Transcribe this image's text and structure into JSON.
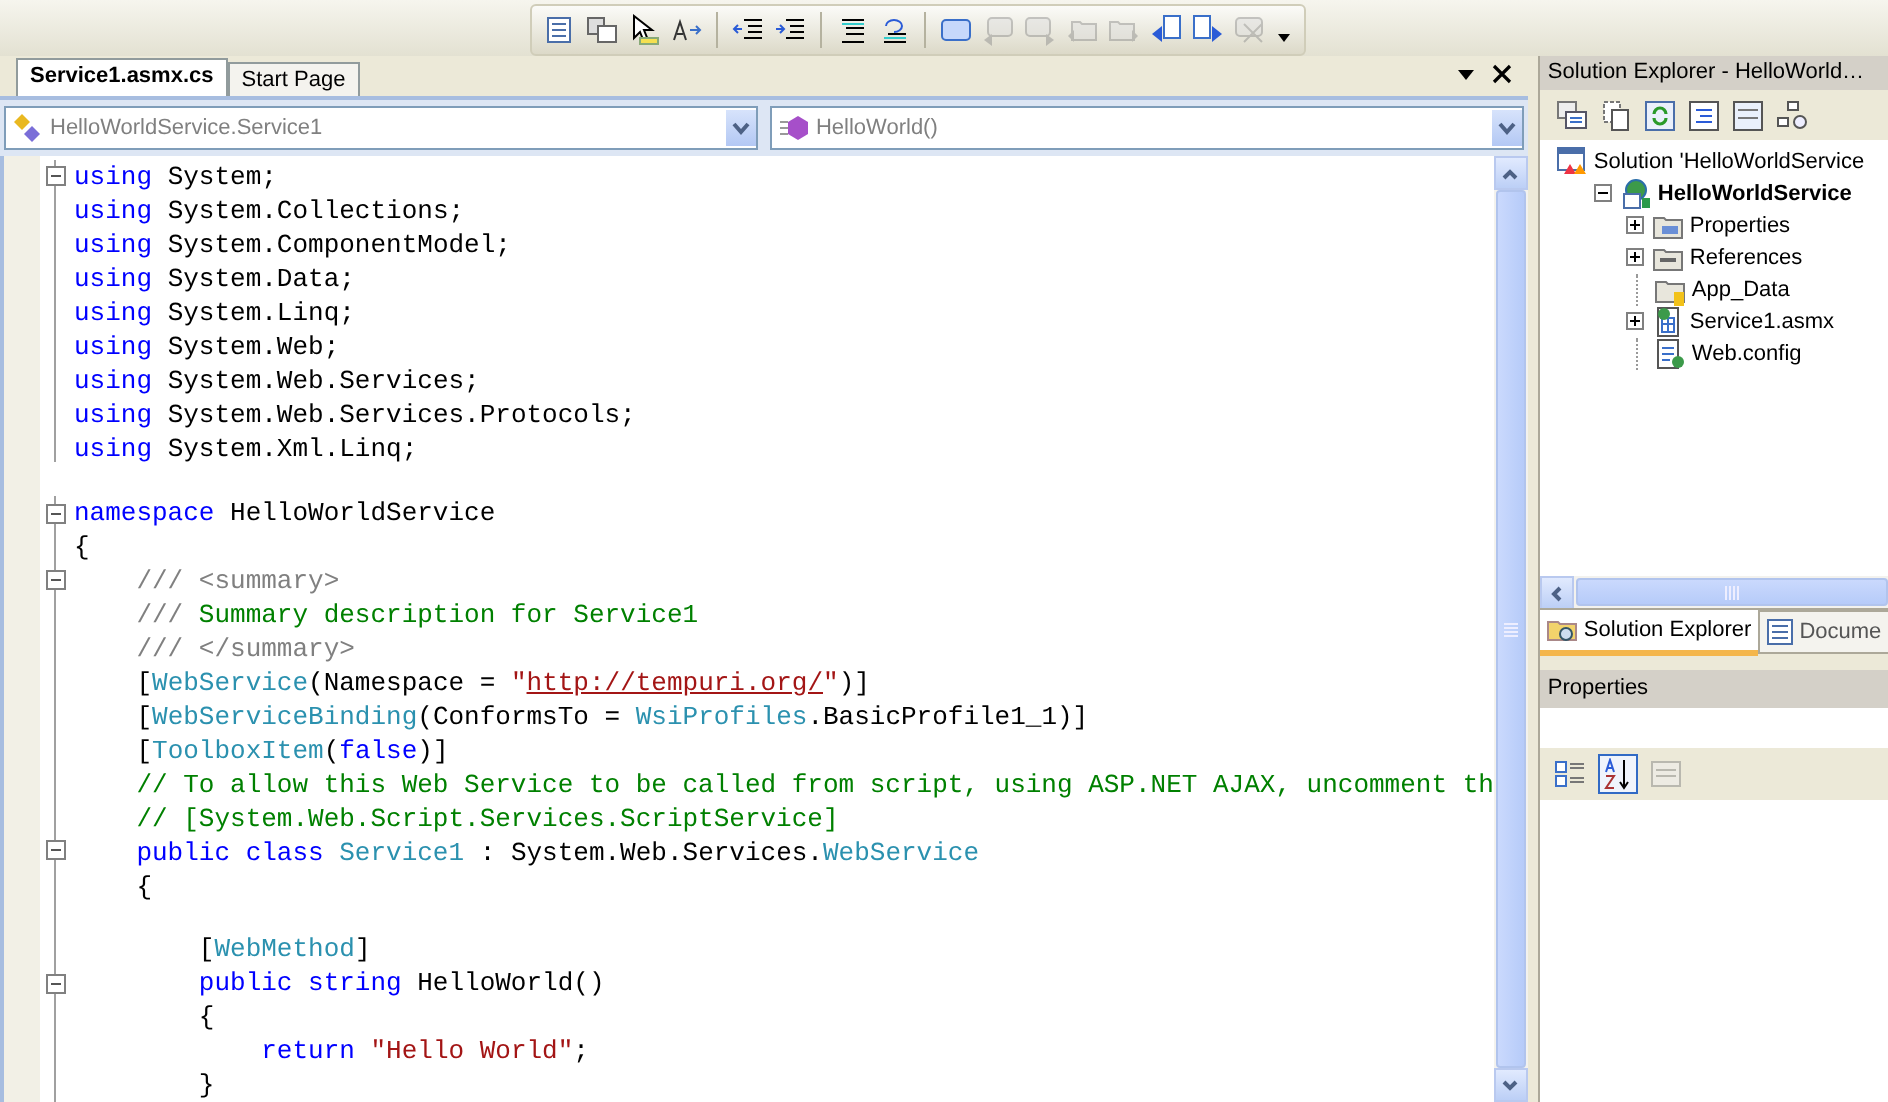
{
  "editor_tabs": [
    {
      "label": "Service1.asmx.cs",
      "selected": true
    },
    {
      "label": "Start Page",
      "selected": false
    }
  ],
  "type_dropdown": {
    "value": "HelloWorldService.Service1"
  },
  "member_dropdown": {
    "value": "HelloWorld()"
  },
  "code_lines": [
    {
      "collapsible": true,
      "tokens": [
        {
          "kind": "kw",
          "text": "using"
        },
        {
          "kind": "plain",
          "text": " System;"
        }
      ]
    },
    {
      "tokens": [
        {
          "kind": "kw",
          "text": "using"
        },
        {
          "kind": "plain",
          "text": " System.Collections;"
        }
      ]
    },
    {
      "tokens": [
        {
          "kind": "kw",
          "text": "using"
        },
        {
          "kind": "plain",
          "text": " System.ComponentModel;"
        }
      ]
    },
    {
      "tokens": [
        {
          "kind": "kw",
          "text": "using"
        },
        {
          "kind": "plain",
          "text": " System.Data;"
        }
      ]
    },
    {
      "tokens": [
        {
          "kind": "kw",
          "text": "using"
        },
        {
          "kind": "plain",
          "text": " System.Linq;"
        }
      ]
    },
    {
      "tokens": [
        {
          "kind": "kw",
          "text": "using"
        },
        {
          "kind": "plain",
          "text": " System.Web;"
        }
      ]
    },
    {
      "tokens": [
        {
          "kind": "kw",
          "text": "using"
        },
        {
          "kind": "plain",
          "text": " System.Web.Services;"
        }
      ]
    },
    {
      "tokens": [
        {
          "kind": "kw",
          "text": "using"
        },
        {
          "kind": "plain",
          "text": " System.Web.Services.Protocols;"
        }
      ]
    },
    {
      "tokens": [
        {
          "kind": "kw",
          "text": "using"
        },
        {
          "kind": "plain",
          "text": " System.Xml.Linq;"
        }
      ]
    },
    {
      "kind": "gap"
    },
    {
      "collapsible": true,
      "tokens": [
        {
          "kind": "kw",
          "text": "namespace"
        },
        {
          "kind": "plain",
          "text": " HelloWorldService"
        }
      ]
    },
    {
      "tokens": [
        {
          "kind": "plain",
          "text": "{"
        }
      ]
    },
    {
      "collapsible": true,
      "tokens": [
        {
          "kind": "doc",
          "text": "    /// <summary>"
        }
      ]
    },
    {
      "tokens": [
        {
          "kind": "doc",
          "text": "    ///"
        },
        {
          "kind": "comment",
          "text": " Summary description for Service1"
        }
      ]
    },
    {
      "tokens": [
        {
          "kind": "doc",
          "text": "    /// </summary>"
        }
      ]
    },
    {
      "tokens": [
        {
          "kind": "plain",
          "text": "    ["
        },
        {
          "kind": "type",
          "text": "WebService"
        },
        {
          "kind": "plain",
          "text": "(Namespace = "
        },
        {
          "kind": "str",
          "text": "\""
        },
        {
          "kind": "link",
          "text": "http://tempuri.org/"
        },
        {
          "kind": "str",
          "text": "\""
        },
        {
          "kind": "plain",
          "text": ")]"
        }
      ]
    },
    {
      "tokens": [
        {
          "kind": "plain",
          "text": "    ["
        },
        {
          "kind": "type",
          "text": "WebServiceBinding"
        },
        {
          "kind": "plain",
          "text": "(ConformsTo = "
        },
        {
          "kind": "type",
          "text": "WsiProfiles"
        },
        {
          "kind": "plain",
          "text": ".BasicProfile1_1)]"
        }
      ]
    },
    {
      "tokens": [
        {
          "kind": "plain",
          "text": "    ["
        },
        {
          "kind": "type",
          "text": "ToolboxItem"
        },
        {
          "kind": "plain",
          "text": "("
        },
        {
          "kind": "kw",
          "text": "false"
        },
        {
          "kind": "plain",
          "text": ")]"
        }
      ]
    },
    {
      "tokens": [
        {
          "kind": "comment",
          "text": "    // To allow this Web Service to be called from script, using ASP.NET AJAX, uncomment th"
        }
      ]
    },
    {
      "tokens": [
        {
          "kind": "comment",
          "text": "    // [System.Web.Script.Services.ScriptService]"
        }
      ]
    },
    {
      "collapsible": true,
      "tokens": [
        {
          "kind": "kw",
          "text": "    public class "
        },
        {
          "kind": "type",
          "text": "Service1"
        },
        {
          "kind": "plain",
          "text": " : System.Web.Services."
        },
        {
          "kind": "type",
          "text": "WebService"
        }
      ]
    },
    {
      "tokens": [
        {
          "kind": "plain",
          "text": "    {"
        }
      ]
    },
    {
      "kind": "blank"
    },
    {
      "tokens": [
        {
          "kind": "plain",
          "text": "        ["
        },
        {
          "kind": "type",
          "text": "WebMethod"
        },
        {
          "kind": "plain",
          "text": "]"
        }
      ]
    },
    {
      "collapsible": true,
      "tokens": [
        {
          "kind": "kw",
          "text": "        public string"
        },
        {
          "kind": "plain",
          "text": " HelloWorld()"
        }
      ]
    },
    {
      "tokens": [
        {
          "kind": "plain",
          "text": "        {"
        }
      ]
    },
    {
      "tokens": [
        {
          "kind": "kw",
          "text": "            return "
        },
        {
          "kind": "str",
          "text": "\"Hello World\""
        },
        {
          "kind": "plain",
          "text": ";"
        }
      ]
    },
    {
      "tokens": [
        {
          "kind": "plain",
          "text": "        }"
        }
      ]
    }
  ],
  "solution_explorer": {
    "title": "Solution Explorer - HelloWorld…",
    "tree": [
      {
        "label": "Solution 'HelloWorldService",
        "kind": "solution",
        "children": [
          {
            "label": "HelloWorldService",
            "kind": "project",
            "expanded": true,
            "children": [
              {
                "label": "Properties",
                "kind": "properties",
                "expanded": false
              },
              {
                "label": "References",
                "kind": "references",
                "expanded": false
              },
              {
                "label": "App_Data",
                "kind": "data"
              },
              {
                "label": "Service1.asmx",
                "kind": "asmx",
                "expanded": false
              },
              {
                "label": "Web.config",
                "kind": "config"
              }
            ]
          }
        ]
      }
    ],
    "tabs": [
      {
        "label": "Solution Explorer",
        "selected": true
      },
      {
        "label": "Docume",
        "selected": false
      }
    ]
  },
  "properties": {
    "title": "Properties",
    "sort_buttons": [
      {
        "kind": "categorized",
        "selected": false
      },
      {
        "kind": "alphabetical",
        "selected": true
      },
      {
        "kind": "pages",
        "selected": false
      }
    ]
  }
}
